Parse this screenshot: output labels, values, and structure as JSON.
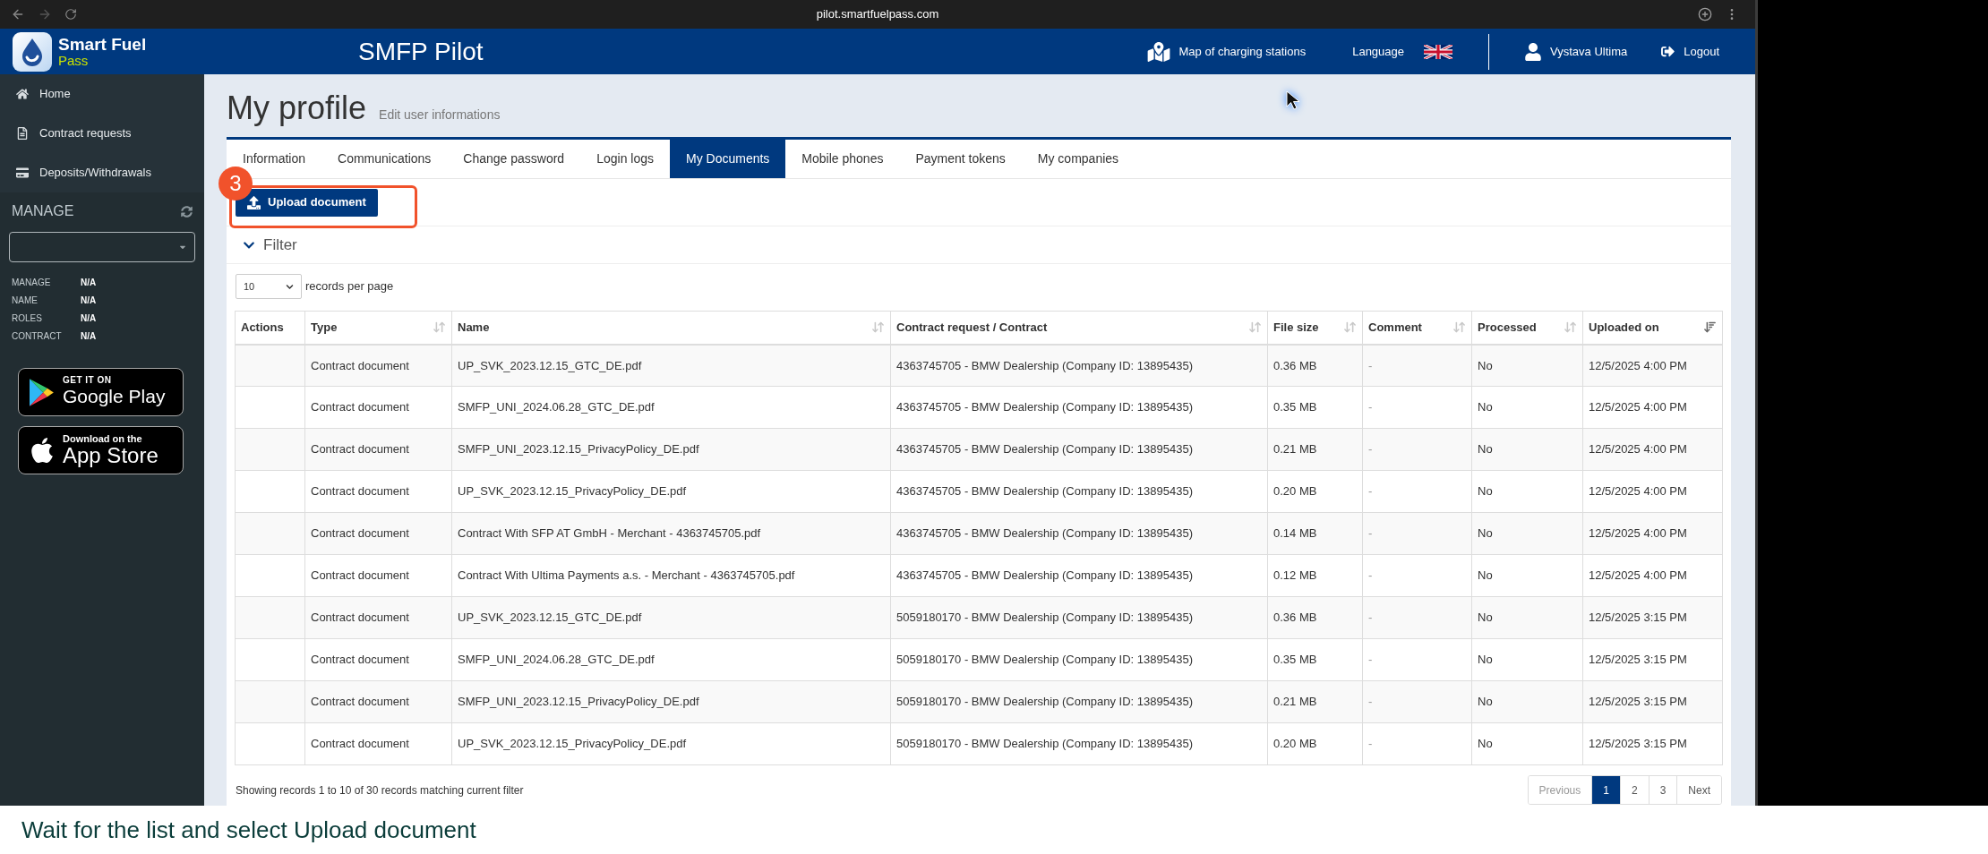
{
  "browser": {
    "url": "pilot.smartfuelpass.com"
  },
  "header": {
    "brand_name": "Smart Fuel",
    "brand_subtitle": "Pass",
    "title": "SMFP Pilot",
    "map_link": "Map of charging stations",
    "language_label": "Language",
    "user_name": "Vystava Ultima",
    "logout": "Logout"
  },
  "sidebar": {
    "items": [
      {
        "label": "Home"
      },
      {
        "label": "Contract requests"
      },
      {
        "label": "Deposits/Withdrawals"
      }
    ],
    "manage_heading": "MANAGE",
    "info": [
      {
        "label": "MANAGE",
        "value": "N/A"
      },
      {
        "label": "NAME",
        "value": "N/A"
      },
      {
        "label": "ROLES",
        "value": "N/A"
      },
      {
        "label": "CONTRACT",
        "value": "N/A"
      }
    ],
    "store_badges": [
      {
        "kind": "google_play",
        "line_1": "GET IT ON",
        "line_2": "Google Play"
      },
      {
        "kind": "app_store",
        "line_1": "Download on the",
        "line_2": "App Store"
      }
    ]
  },
  "page": {
    "title": "My profile",
    "subtitle": "Edit user informations"
  },
  "tabs": [
    {
      "label": "Information",
      "selected": false
    },
    {
      "label": "Communications",
      "selected": false
    },
    {
      "label": "Change password",
      "selected": false
    },
    {
      "label": "Login logs",
      "selected": false
    },
    {
      "label": "My Documents",
      "selected": true
    },
    {
      "label": "Mobile phones",
      "selected": false
    },
    {
      "label": "Payment tokens",
      "selected": false
    },
    {
      "label": "My companies",
      "selected": false
    }
  ],
  "upload_button": "Upload document",
  "step_marker": "3",
  "filter": {
    "label": "Filter"
  },
  "page_size": {
    "value": "10",
    "label": "records per page"
  },
  "table": {
    "columns": [
      {
        "label": "Actions",
        "kind": "plain"
      },
      {
        "label": "Type",
        "kind": "sortable"
      },
      {
        "label": "Name",
        "kind": "sortable"
      },
      {
        "label": "Contract request / Contract",
        "kind": "sortable"
      },
      {
        "label": "File size",
        "kind": "sortable"
      },
      {
        "label": "Comment",
        "kind": "sortable"
      },
      {
        "label": "Processed",
        "kind": "sortable"
      },
      {
        "label": "Uploaded on",
        "kind": "sorted"
      }
    ],
    "rows": [
      {
        "type": "Contract document",
        "name": "UP_SVK_2023.12.15_GTC_DE.pdf",
        "contract": "4363745705 - BMW Dealership (Company ID: 13895435)",
        "file_size": "0.36 MB",
        "comment": "-",
        "processed": "No",
        "uploaded_on": "12/5/2025 4:00 PM"
      },
      {
        "type": "Contract document",
        "name": "SMFP_UNI_2024.06.28_GTC_DE.pdf",
        "contract": "4363745705 - BMW Dealership (Company ID: 13895435)",
        "file_size": "0.35 MB",
        "comment": "-",
        "processed": "No",
        "uploaded_on": "12/5/2025 4:00 PM"
      },
      {
        "type": "Contract document",
        "name": "SMFP_UNI_2023.12.15_PrivacyPolicy_DE.pdf",
        "contract": "4363745705 - BMW Dealership (Company ID: 13895435)",
        "file_size": "0.21 MB",
        "comment": "-",
        "processed": "No",
        "uploaded_on": "12/5/2025 4:00 PM"
      },
      {
        "type": "Contract document",
        "name": "UP_SVK_2023.12.15_PrivacyPolicy_DE.pdf",
        "contract": "4363745705 - BMW Dealership (Company ID: 13895435)",
        "file_size": "0.20 MB",
        "comment": "-",
        "processed": "No",
        "uploaded_on": "12/5/2025 4:00 PM"
      },
      {
        "type": "Contract document",
        "name": "Contract With SFP AT GmbH - Merchant - 4363745705.pdf",
        "contract": "4363745705 - BMW Dealership (Company ID: 13895435)",
        "file_size": "0.14 MB",
        "comment": "-",
        "processed": "No",
        "uploaded_on": "12/5/2025 4:00 PM"
      },
      {
        "type": "Contract document",
        "name": "Contract With Ultima Payments a.s. - Merchant - 4363745705.pdf",
        "contract": "4363745705 - BMW Dealership (Company ID: 13895435)",
        "file_size": "0.12 MB",
        "comment": "-",
        "processed": "No",
        "uploaded_on": "12/5/2025 4:00 PM"
      },
      {
        "type": "Contract document",
        "name": "UP_SVK_2023.12.15_GTC_DE.pdf",
        "contract": "5059180170 - BMW Dealership (Company ID: 13895435)",
        "file_size": "0.36 MB",
        "comment": "-",
        "processed": "No",
        "uploaded_on": "12/5/2025 3:15 PM"
      },
      {
        "type": "Contract document",
        "name": "SMFP_UNI_2024.06.28_GTC_DE.pdf",
        "contract": "5059180170 - BMW Dealership (Company ID: 13895435)",
        "file_size": "0.35 MB",
        "comment": "-",
        "processed": "No",
        "uploaded_on": "12/5/2025 3:15 PM"
      },
      {
        "type": "Contract document",
        "name": "SMFP_UNI_2023.12.15_PrivacyPolicy_DE.pdf",
        "contract": "5059180170 - BMW Dealership (Company ID: 13895435)",
        "file_size": "0.21 MB",
        "comment": "-",
        "processed": "No",
        "uploaded_on": "12/5/2025 3:15 PM"
      },
      {
        "type": "Contract document",
        "name": "UP_SVK_2023.12.15_PrivacyPolicy_DE.pdf",
        "contract": "5059180170 - BMW Dealership (Company ID: 13895435)",
        "file_size": "0.20 MB",
        "comment": "-",
        "processed": "No",
        "uploaded_on": "12/5/2025 3:15 PM"
      }
    ]
  },
  "footer": {
    "summary": "Showing records 1 to 10 of 30 records matching current filter",
    "pagination": [
      {
        "label": "Previous",
        "selected": false,
        "disabled": true
      },
      {
        "label": "1",
        "selected": true,
        "disabled": false
      },
      {
        "label": "2",
        "selected": false,
        "disabled": false
      },
      {
        "label": "3",
        "selected": false,
        "disabled": false
      },
      {
        "label": "Next",
        "selected": false,
        "disabled": false
      }
    ]
  },
  "caption": "Wait for the list and select Upload document"
}
